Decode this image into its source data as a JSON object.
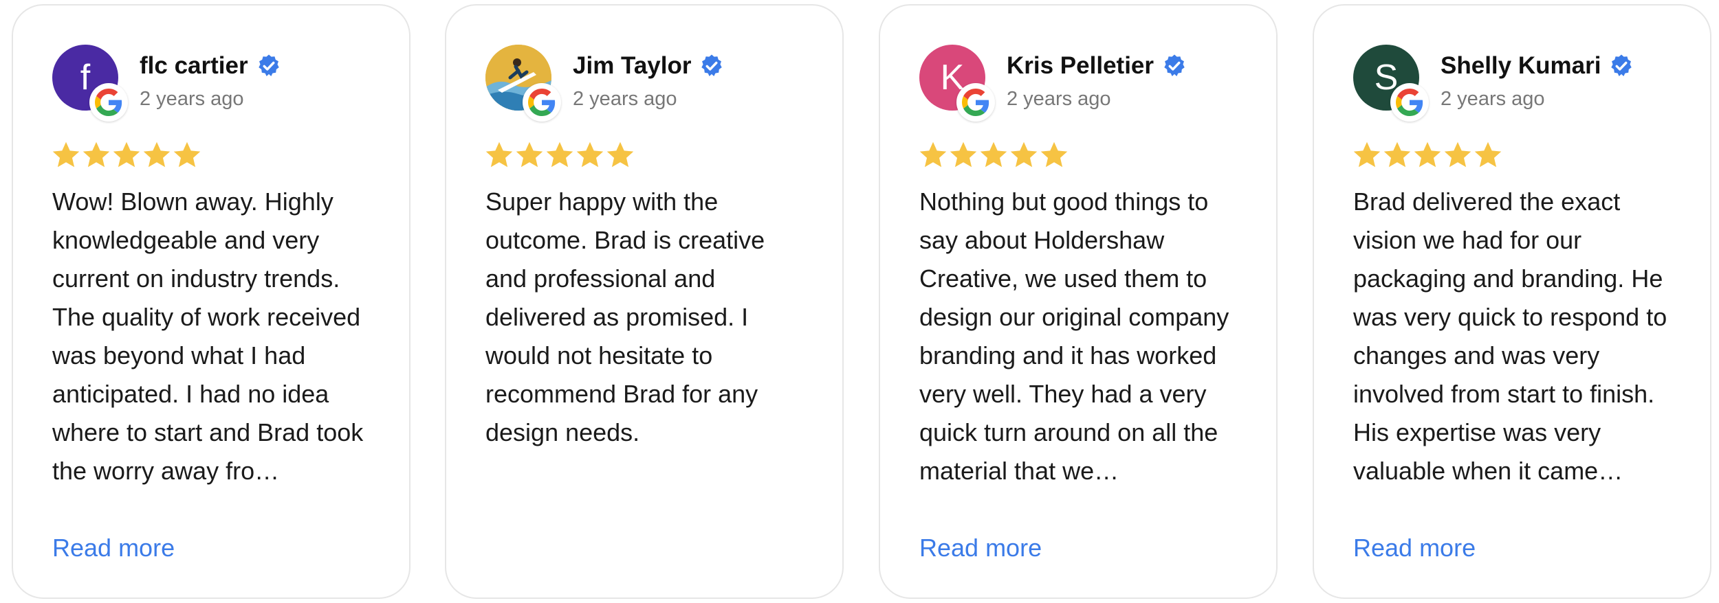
{
  "accent_color": "#3b7be8",
  "star_color": "#f6c343",
  "reviews": [
    {
      "name": "flc cartier",
      "time": "2 years ago",
      "avatar_initial": "f",
      "avatar_color": "#4a2aa3",
      "rating": 5,
      "text": "Wow! Blown away. Highly knowledgeable and very current on industry trends. The quality of work received was beyond what I had anticipated. I had no idea where to start and Brad took the worry away fro…",
      "read_more": "Read more"
    },
    {
      "name": "Jim Taylor",
      "time": "2 years ago",
      "avatar_initial": "",
      "avatar_color": "#e2b33d",
      "rating": 5,
      "text": "Super happy with the outcome. Brad is creative and professional and delivered as promised. I would not hesitate to recommend Brad for any design needs.",
      "read_more": ""
    },
    {
      "name": "Kris Pelletier",
      "time": "2 years ago",
      "avatar_initial": "K",
      "avatar_color": "#d9487a",
      "rating": 5,
      "text": "Nothing but good things to say about Holdershaw Creative, we used them to design our original company branding and it has worked very well. They had a very quick turn around on all the material that we…",
      "read_more": "Read more"
    },
    {
      "name": "Shelly Kumari",
      "time": "2 years ago",
      "avatar_initial": "S",
      "avatar_color": "#1f4a3b",
      "rating": 5,
      "text": "Brad delivered the exact vision we had for our packaging and branding. He was very quick to respond to changes and was very involved from start to finish. His expertise was very valuable when it came…",
      "read_more": "Read more"
    }
  ]
}
